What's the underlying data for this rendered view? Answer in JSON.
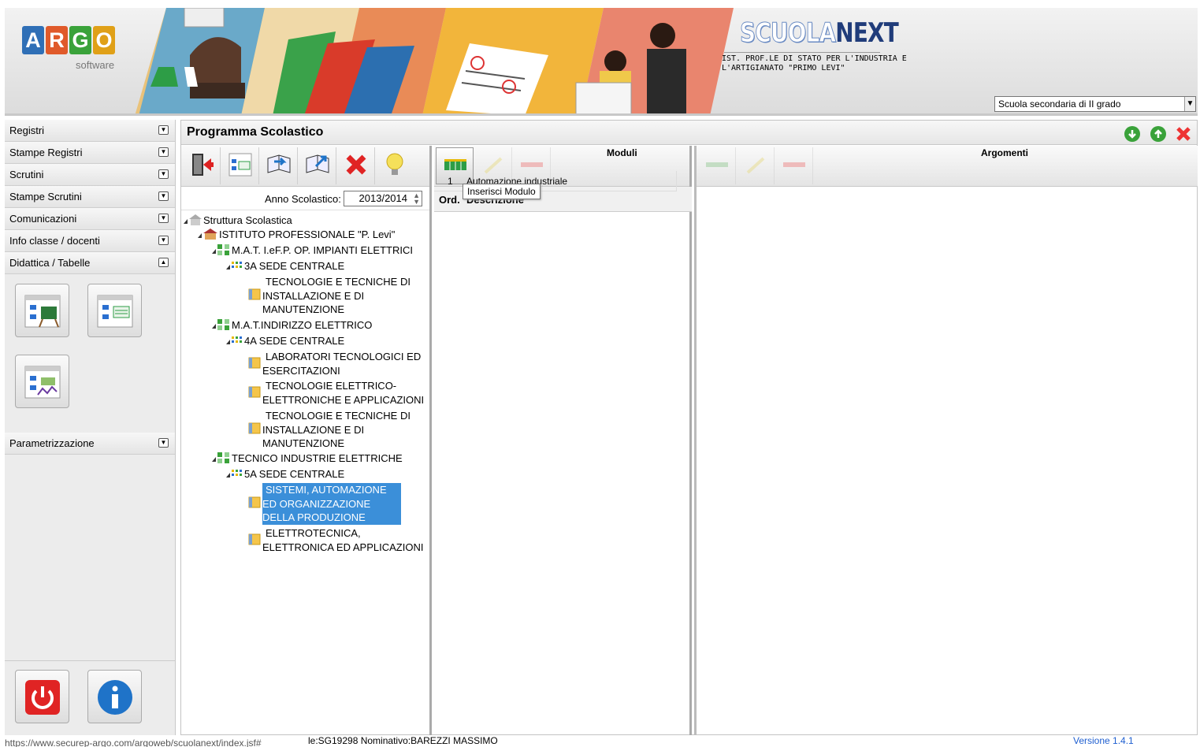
{
  "header": {
    "logo_letters": [
      "A",
      "R",
      "G",
      "O"
    ],
    "logo_colors": [
      "#2f6fb6",
      "#e05a2a",
      "#3aa23a",
      "#e0a017"
    ],
    "logo_sub": "software",
    "brand_a": "SCUOLA",
    "brand_b": "NEXT",
    "school_name": "IST. PROF.LE DI STATO PER L'INDUSTRIA E L'ARTIGIANATO \"PRIMO LEVI\"",
    "school_type_selected": "Scuola secondaria di II grado"
  },
  "sidebar": {
    "sections": [
      "Registri",
      "Stampe Registri",
      "Scrutini",
      "Stampe Scrutini",
      "Comunicazioni",
      "Info classe / docenti",
      "Didattica / Tabelle"
    ],
    "last_section": "Parametrizzazione"
  },
  "main": {
    "title": "Programma Scolastico",
    "anno_label": "Anno Scolastico:",
    "anno_value": "2013/2014",
    "moduli_title": "Moduli",
    "argomenti_title": "Argomenti",
    "col_ord": "Ord.",
    "col_desc": "Descrizione",
    "modules": [
      {
        "ord": "1",
        "desc": "Automazione industriale"
      }
    ],
    "tooltip": "Inserisci Modulo"
  },
  "tree": {
    "root": "Struttura Scolastica",
    "institute": "ISTITUTO PROFESSIONALE \"P. Levi\"",
    "ind1": "M.A.T. I.eF.P. OP. IMPIANTI ELETTRICI",
    "cls1": "3A SEDE CENTRALE",
    "m1": "TECNOLOGIE E TECNICHE DI INSTALLAZIONE E DI MANUTENZIONE",
    "ind2": "M.A.T.INDIRIZZO ELETTRICO",
    "cls2": "4A SEDE CENTRALE",
    "m2": "LABORATORI TECNOLOGICI ED ESERCITAZIONI",
    "m3": "TECNOLOGIE ELETTRICO-ELETTRONICHE E APPLICAZIONI",
    "m4": "TECNOLOGIE E TECNICHE DI INSTALLAZIONE E DI MANUTENZIONE",
    "ind3": "TECNICO INDUSTRIE ELETTRICHE",
    "cls3": "5A SEDE CENTRALE",
    "m5": "SISTEMI, AUTOMAZIONE ED ORGANIZZAZIONE DELLA PRODUZIONE",
    "m6": "ELETTROTECNICA, ELETTRONICA ED APPLICAZIONI"
  },
  "status": {
    "url": "https://www.securep-argo.com/argoweb/scuolanext/index.jsf#",
    "user": "le:SG19298 Nominativo:BAREZZI MASSIMO",
    "version": "Versione 1.4.1"
  }
}
